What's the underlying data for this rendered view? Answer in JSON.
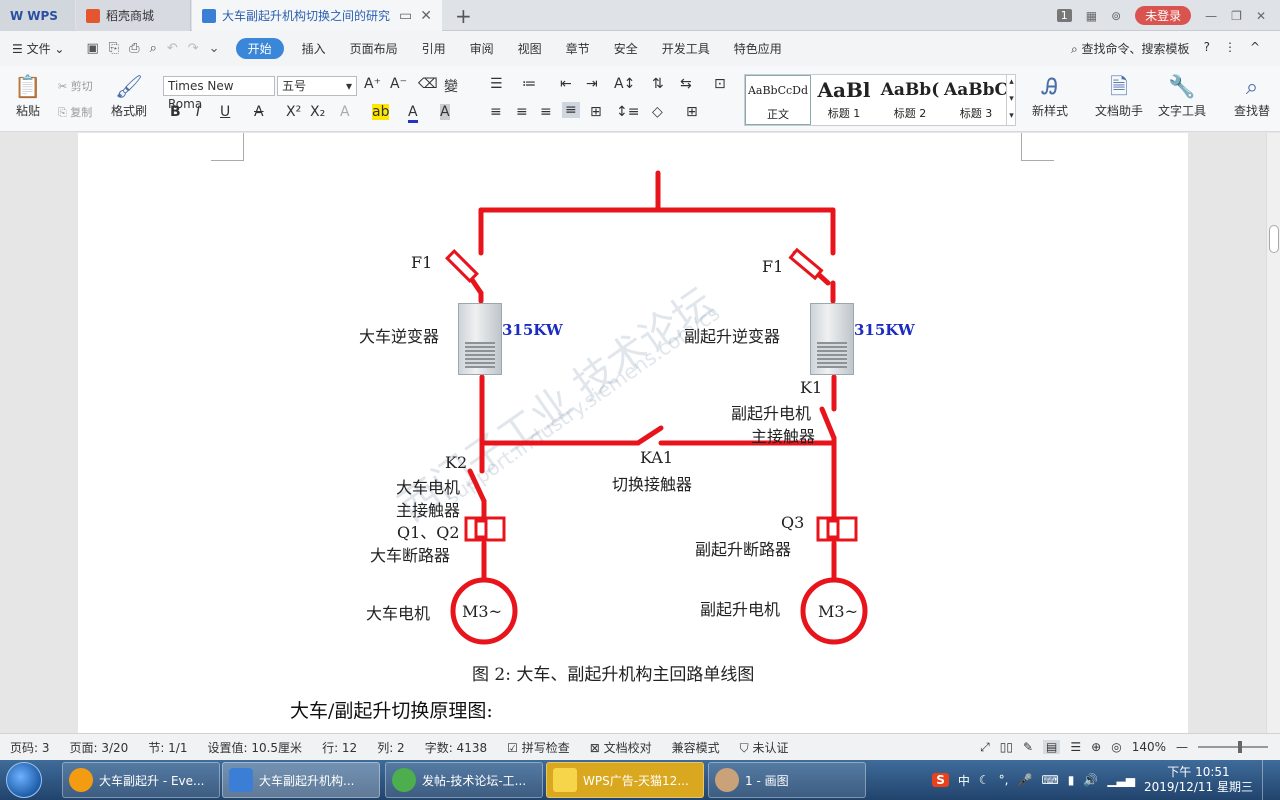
{
  "titlebar": {
    "tabs": [
      {
        "label": "WPS"
      },
      {
        "label": "稻壳商城"
      },
      {
        "label": "大车副起升机构切换之间的研究"
      }
    ],
    "page_count_badge": "1",
    "login_label": "未登录"
  },
  "menu": {
    "file_label": "文件",
    "items": [
      "开始",
      "插入",
      "页面布局",
      "引用",
      "审阅",
      "视图",
      "章节",
      "安全",
      "开发工具",
      "特色应用"
    ],
    "search_label": "查找命令、搜索模板"
  },
  "ribbon": {
    "paste": "粘贴",
    "cut": "剪切",
    "copy": "复制",
    "format_painter": "格式刷",
    "font_name": "Times New Roma",
    "font_size": "五号",
    "styles": [
      {
        "sample": "AaBbCcDd",
        "label": "正文"
      },
      {
        "sample": "AaBl",
        "label": "标题 1"
      },
      {
        "sample": "AaBb(",
        "label": "标题 2"
      },
      {
        "sample": "AaBbC",
        "label": "标题 3"
      }
    ],
    "new_style": "新样式",
    "doc_assistant": "文档助手",
    "text_tools": "文字工具",
    "find_replace": "查找替"
  },
  "diagram": {
    "left": {
      "fuse": "F1",
      "inverter": "大车逆变器",
      "power": "315KW",
      "contactor_tag": "K2",
      "contactor_name_1": "大车电机",
      "contactor_name_2": "主接触器",
      "breaker_tag": "Q1、Q2",
      "breaker_name": "大车断路器",
      "motor_name": "大车电机",
      "motor_symbol": "M3~"
    },
    "right": {
      "fuse": "F1",
      "inverter": "副起升逆变器",
      "power": "315KW",
      "contactor_tag": "K1",
      "contactor_name_1": "副起升电机",
      "contactor_name_2": "主接触器",
      "breaker_tag": "Q3",
      "breaker_name": "副起升断路器",
      "motor_name": "副起升电机",
      "motor_symbol": "M3~"
    },
    "switch_tag": "KA1",
    "switch_name": "切换接触器",
    "line_color": "#e8141c",
    "watermark_cn": "西门子工业  技术论坛",
    "watermark_url": "support.industry.siemens.com/cs"
  },
  "document": {
    "caption": "图 2:  大车、副起升机构主回路单线图",
    "heading": "大车/副起升切换原理图:"
  },
  "statusbar": {
    "page_no": "页码: 3",
    "pages": "页面: 3/20",
    "section": "节: 1/1",
    "setting": "设置值: 10.5厘米",
    "row": "行: 12",
    "col": "列: 2",
    "words": "字数: 4138",
    "spellcheck": "拼写检查",
    "proofread": "文档校对",
    "compat": "兼容模式",
    "cert": "未认证",
    "zoom": "140%"
  },
  "taskbar": {
    "items": [
      {
        "label": "大车副起升 - Eve..."
      },
      {
        "label": "大车副起升机构..."
      },
      {
        "label": "发帖-技术论坛-工..."
      },
      {
        "label": "WPS广告-天猫12..."
      },
      {
        "label": "1 - 画图"
      }
    ],
    "ime_label": "中",
    "time": "下午 10:51",
    "date": "2019/12/11 星期三"
  }
}
